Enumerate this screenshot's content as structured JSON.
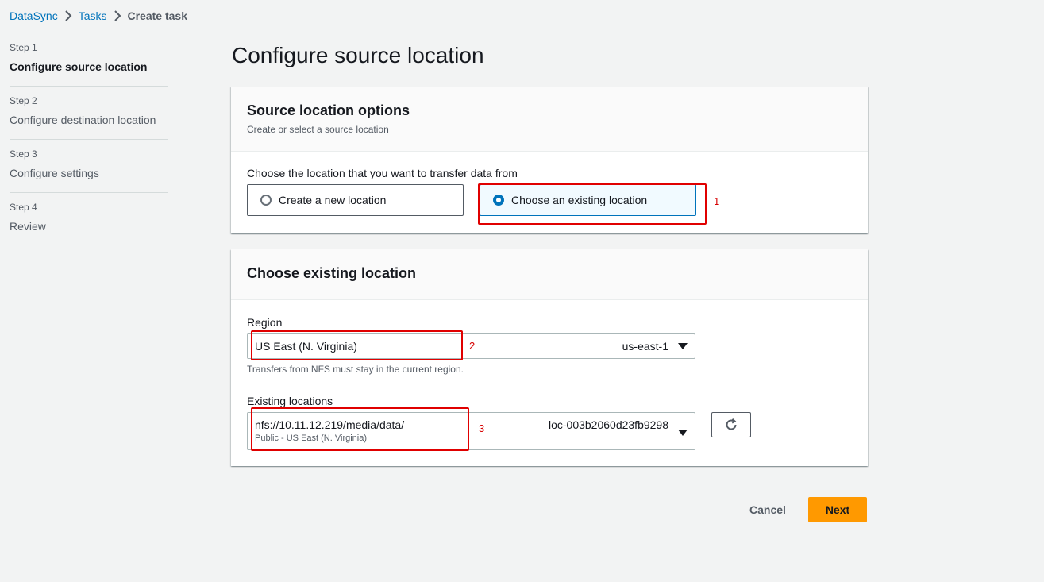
{
  "breadcrumb": {
    "items": [
      "DataSync",
      "Tasks"
    ],
    "current": "Create task"
  },
  "steps": [
    {
      "num": "Step 1",
      "title": "Configure source location"
    },
    {
      "num": "Step 2",
      "title": "Configure destination location"
    },
    {
      "num": "Step 3",
      "title": "Configure settings"
    },
    {
      "num": "Step 4",
      "title": "Review"
    }
  ],
  "page_title": "Configure source location",
  "source_options": {
    "title": "Source location options",
    "description": "Create or select a source location",
    "question": "Choose the location that you want to transfer data from",
    "options": [
      "Create a new location",
      "Choose an existing location"
    ],
    "selected": "Choose an existing location"
  },
  "existing": {
    "title": "Choose existing location",
    "region_label": "Region",
    "region_value": "US East (N. Virginia)",
    "region_code": "us-east-1",
    "region_hint": "Transfers from NFS must stay in the current region.",
    "locations_label": "Existing locations",
    "location_value": "nfs://10.11.12.219/media/data/",
    "location_sub": "Public - US East (N. Virginia)",
    "location_id": "loc-003b2060d23fb9298"
  },
  "annotations": [
    "1",
    "2",
    "3"
  ],
  "footer": {
    "cancel": "Cancel",
    "next": "Next"
  },
  "colors": {
    "accent": "#0073bb",
    "primary_button": "#ff9900",
    "annotation": "#e00000"
  }
}
